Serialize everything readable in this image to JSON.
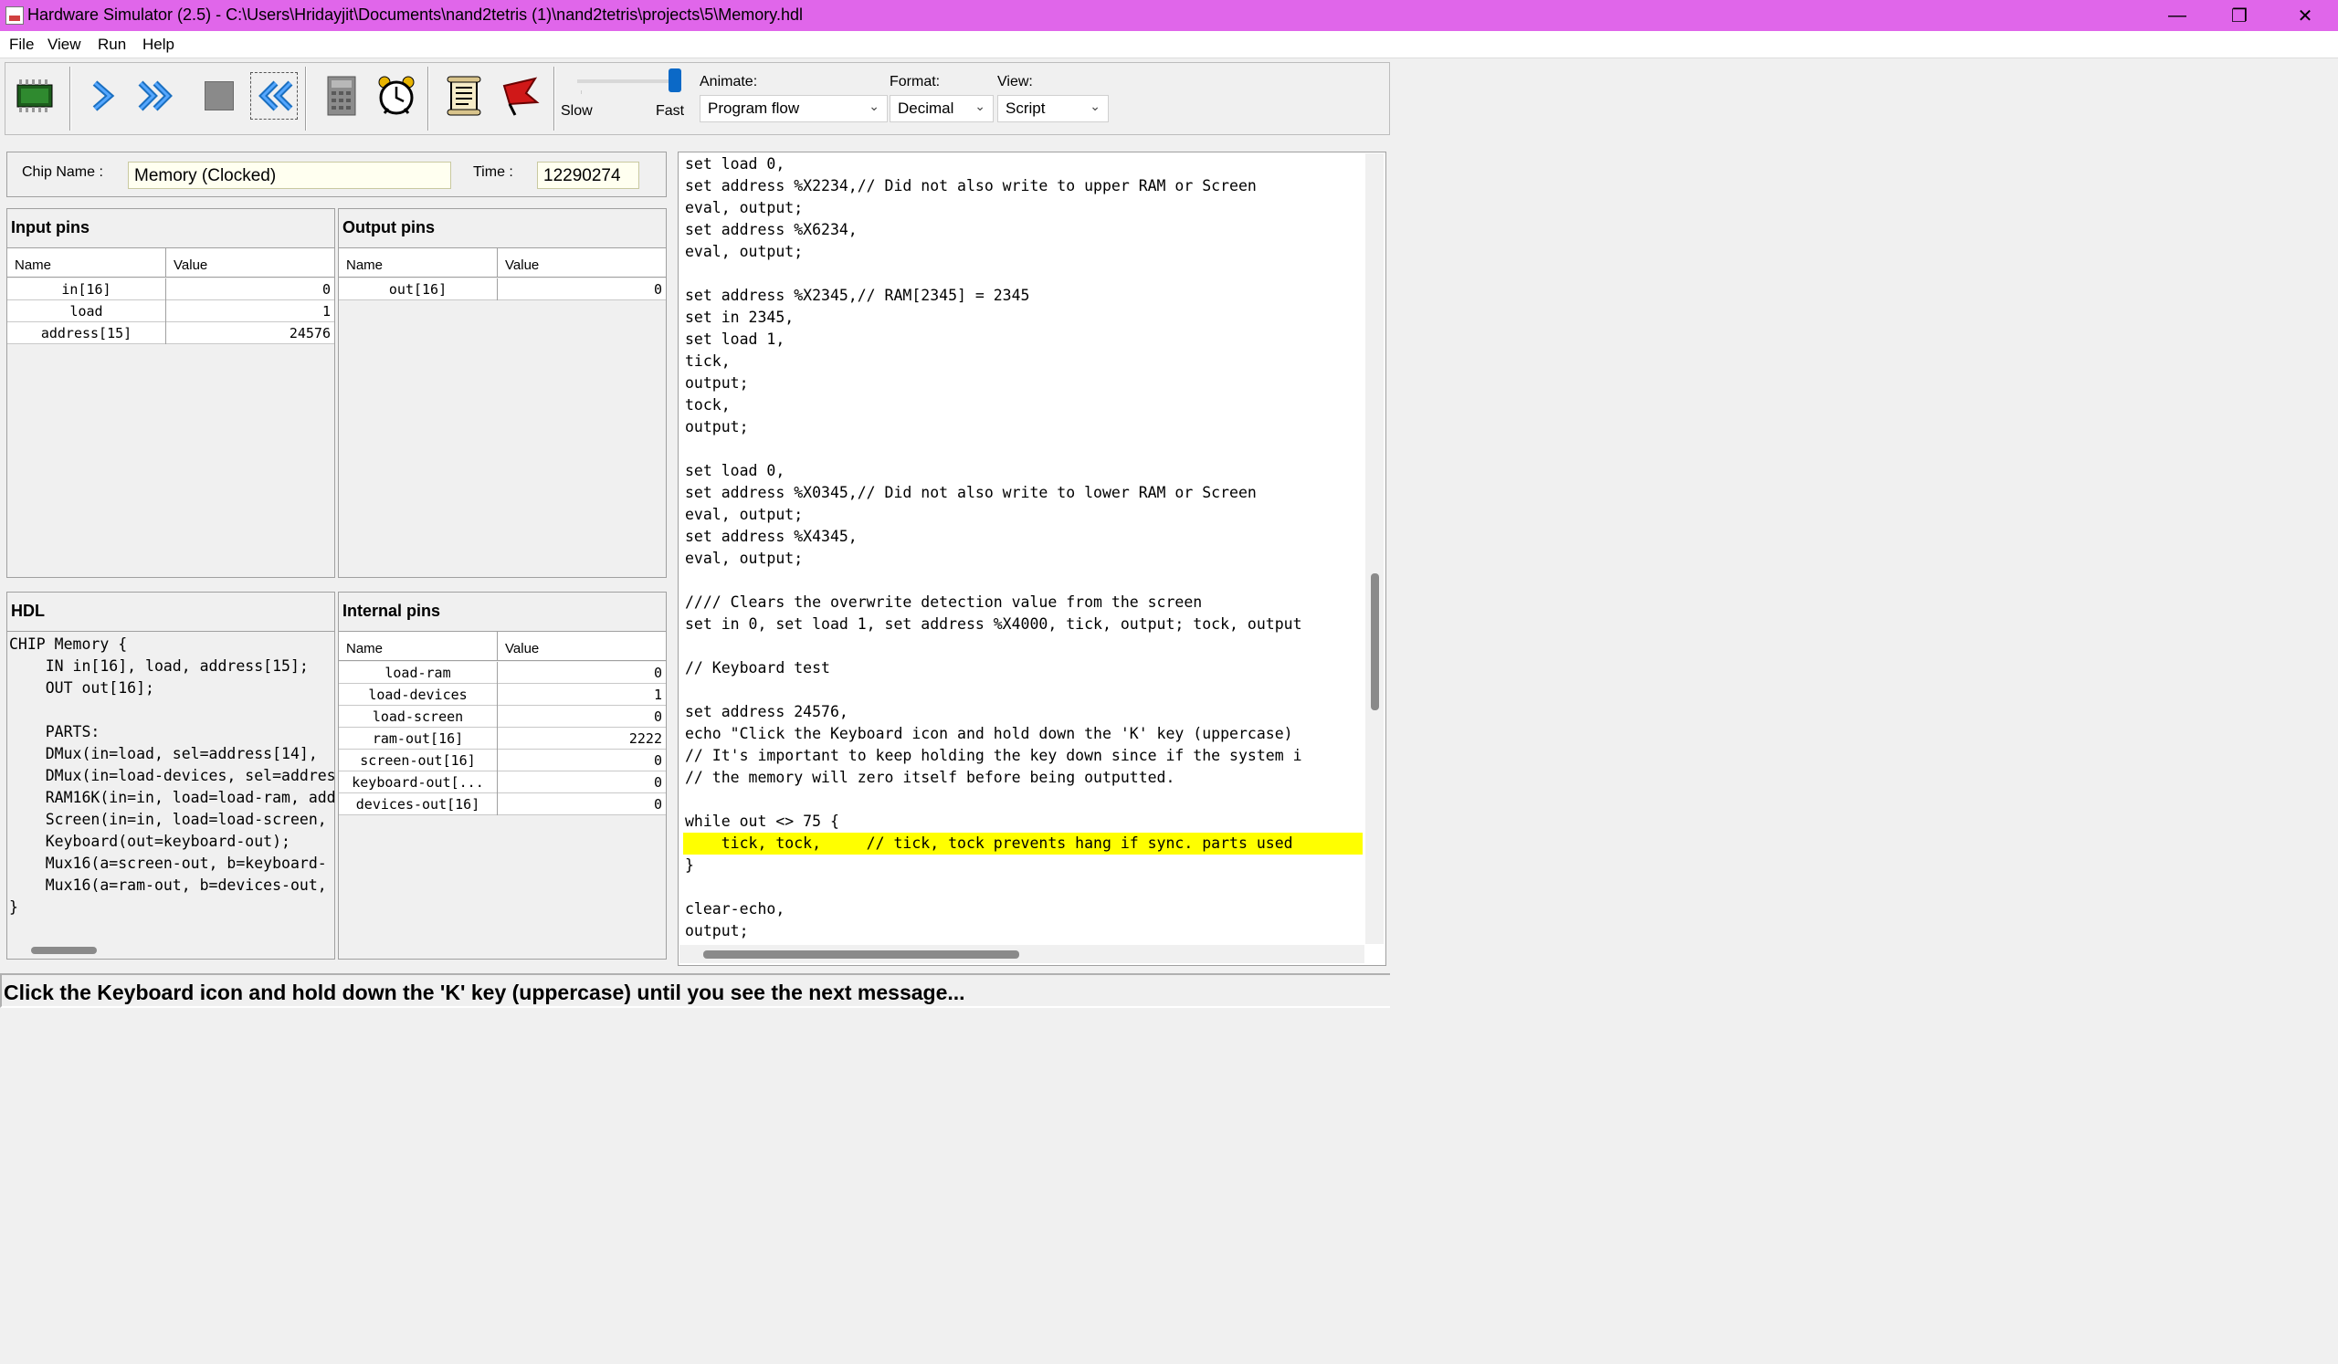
{
  "window": {
    "title": "Hardware Simulator (2.5) - C:\\Users\\Hridayjit\\Documents\\nand2tetris (1)\\nand2tetris\\projects\\5\\Memory.hdl",
    "minimize_glyph": "—",
    "restore_glyph": "❐",
    "close_glyph": "✕"
  },
  "menu": {
    "file": "File",
    "view": "View",
    "run": "Run",
    "help": "Help"
  },
  "toolbar": {
    "icons": [
      "chip-load-icon",
      "single-step-icon",
      "fast-forward-icon",
      "stop-icon",
      "rewind-icon",
      "eval-calculator-icon",
      "clock-icon",
      "script-icon",
      "breakpoint-flag-icon"
    ],
    "speed_slow": "Slow",
    "speed_fast": "Fast",
    "speed_level": 1.0,
    "animate_label": "Animate:",
    "animate_value": "Program flow",
    "format_label": "Format:",
    "format_value": "Decimal",
    "view_label": "View:",
    "view_value": "Script"
  },
  "chip": {
    "name_label": "Chip Name :",
    "name_value": "Memory (Clocked)",
    "time_label": "Time :",
    "time_value": "12290274"
  },
  "input_pins": {
    "title": "Input pins",
    "headers": [
      "Name",
      "Value"
    ],
    "rows": [
      {
        "name": "in[16]",
        "value": "0"
      },
      {
        "name": "load",
        "value": "1"
      },
      {
        "name": "address[15]",
        "value": "24576"
      }
    ]
  },
  "output_pins": {
    "title": "Output pins",
    "headers": [
      "Name",
      "Value"
    ],
    "rows": [
      {
        "name": "out[16]",
        "value": "0"
      }
    ]
  },
  "hdl": {
    "title": "HDL",
    "lines": [
      "CHIP Memory {",
      "    IN in[16], load, address[15];",
      "    OUT out[16];",
      "",
      "    PARTS:",
      "    DMux(in=load, sel=address[14],",
      "    DMux(in=load-devices, sel=address",
      "    RAM16K(in=in, load=load-ram, add",
      "    Screen(in=in, load=load-screen,",
      "    Keyboard(out=keyboard-out);",
      "    Mux16(a=screen-out, b=keyboard-",
      "    Mux16(a=ram-out, b=devices-out,",
      "}"
    ]
  },
  "internal_pins": {
    "title": "Internal pins",
    "headers": [
      "Name",
      "Value"
    ],
    "rows": [
      {
        "name": "load-ram",
        "value": "0"
      },
      {
        "name": "load-devices",
        "value": "1"
      },
      {
        "name": "load-screen",
        "value": "0"
      },
      {
        "name": "ram-out[16]",
        "value": "2222"
      },
      {
        "name": "screen-out[16]",
        "value": "0"
      },
      {
        "name": "keyboard-out[...",
        "value": "0"
      },
      {
        "name": "devices-out[16]",
        "value": "0"
      }
    ]
  },
  "script": {
    "lines": [
      "set load 0,",
      "set address %X2234,// Did not also write to upper RAM or Screen",
      "eval, output;",
      "set address %X6234,",
      "eval, output;",
      "",
      "set address %X2345,// RAM[2345] = 2345",
      "set in 2345,",
      "set load 1,",
      "tick,",
      "output;",
      "tock,",
      "output;",
      "",
      "set load 0,",
      "set address %X0345,// Did not also write to lower RAM or Screen",
      "eval, output;",
      "set address %X4345,",
      "eval, output;",
      "",
      "//// Clears the overwrite detection value from the screen",
      "set in 0, set load 1, set address %X4000, tick, output; tock, output",
      "",
      "// Keyboard test",
      "",
      "set address 24576,",
      "echo \"Click the Keyboard icon and hold down the 'K' key (uppercase)",
      "// It's important to keep holding the key down since if the system i",
      "// the memory will zero itself before being outputted.",
      "",
      "while out <> 75 {",
      "    tick, tock,     // tick, tock prevents hang if sync. parts used",
      "}",
      "",
      "clear-echo,",
      "output;"
    ],
    "highlight_index": 31,
    "highlight_color": "#ffff00"
  },
  "status": {
    "message": "Click the Keyboard icon and hold down the 'K' key (uppercase) until you see the next message..."
  }
}
